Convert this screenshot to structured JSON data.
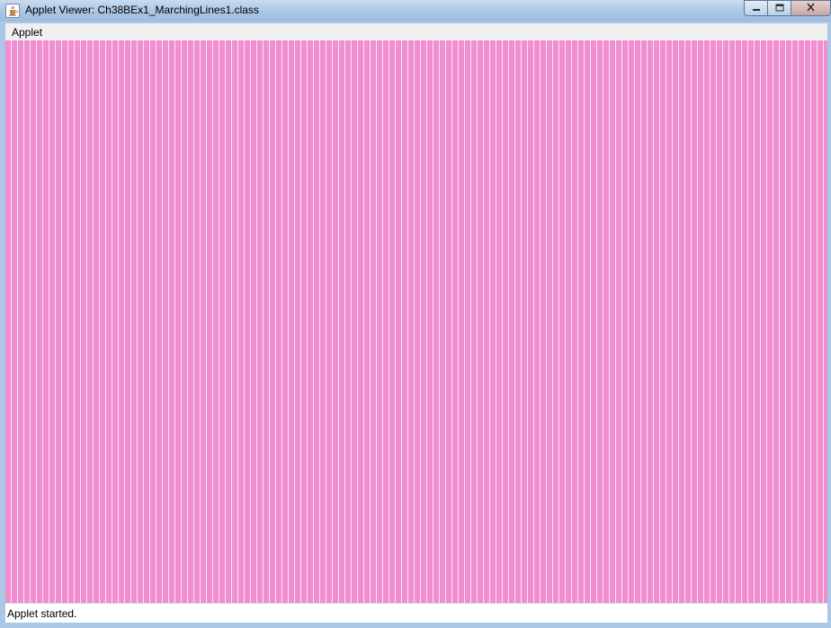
{
  "window": {
    "title": "Applet Viewer: Ch38BEx1_MarchingLines1.class",
    "app_icon": "java-cup-icon",
    "controls": [
      "minimize-icon",
      "maximize-icon",
      "close-icon"
    ]
  },
  "menubar": {
    "items": [
      {
        "label": "Applet"
      }
    ]
  },
  "canvas": {
    "fill_color": "#f08ecf",
    "line_color": "#fbe4f3"
  },
  "statusbar": {
    "text": "Applet started."
  }
}
